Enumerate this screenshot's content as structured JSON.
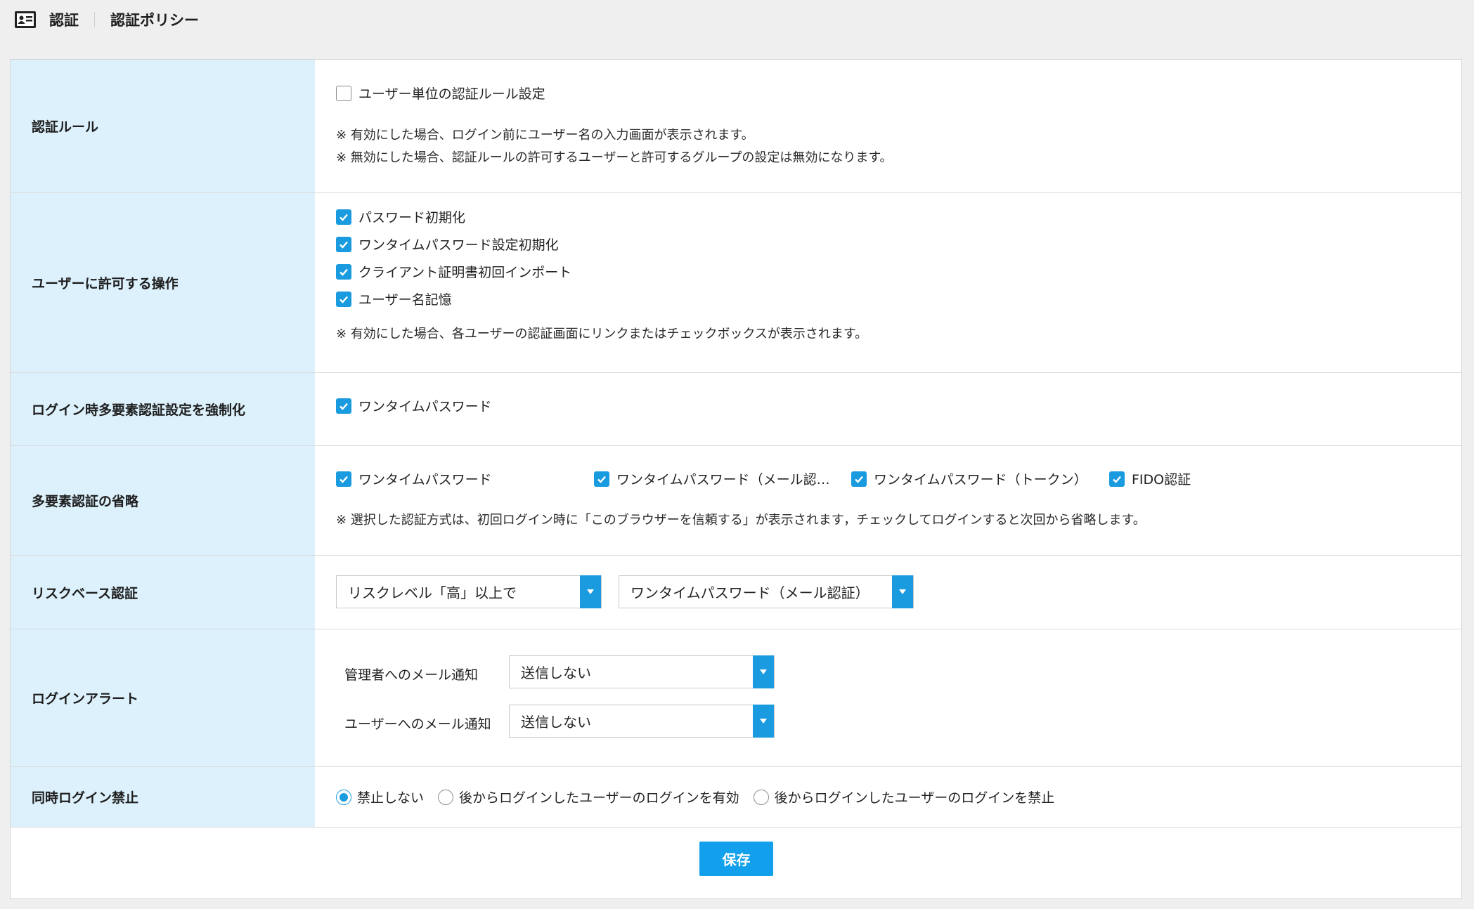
{
  "breadcrumb": [
    "認証",
    "認証ポリシー"
  ],
  "colors": {
    "accent": "#1a9be0",
    "label_bg": "#dcf1fc",
    "page_bg": "#efefef"
  },
  "sections": {
    "auth_rule": {
      "label": "認証ルール",
      "checkbox": {
        "label": "ユーザー単位の認証ルール設定",
        "checked": false
      },
      "notes": [
        "※ 有効にした場合、ログイン前にユーザー名の入力画面が表示されます。",
        "※ 無効にした場合、認証ルールの許可するユーザーと許可するグループの設定は無効になります。"
      ]
    },
    "user_ops": {
      "label": "ユーザーに許可する操作",
      "options": [
        {
          "label": "パスワード初期化",
          "checked": true
        },
        {
          "label": "ワンタイムパスワード設定初期化",
          "checked": true
        },
        {
          "label": "クライアント証明書初回インポート",
          "checked": true
        },
        {
          "label": "ユーザー名記憶",
          "checked": true
        }
      ],
      "note": "※ 有効にした場合、各ユーザーの認証画面にリンクまたはチェックボックスが表示されます。"
    },
    "mfa_force": {
      "label": "ログイン時多要素認証設定を強制化",
      "checkbox": {
        "label": "ワンタイムパスワード",
        "checked": true
      }
    },
    "mfa_skip": {
      "label": "多要素認証の省略",
      "options": [
        {
          "label": "ワンタイムパスワード",
          "checked": true
        },
        {
          "label": "ワンタイムパスワード（メール認…",
          "checked": true
        },
        {
          "label": "ワンタイムパスワード（トークン）",
          "checked": true
        },
        {
          "label": "FIDO認証",
          "checked": true
        }
      ],
      "note": "※ 選択した認証方式は、初回ログイン時に「このブラウザーを信頼する」が表示されます，チェックしてログインすると次回から省略します。"
    },
    "risk_based": {
      "label": "リスクベース認証",
      "level_select": "リスクレベル「高」以上で",
      "method_select": "ワンタイムパスワード（メール認証）"
    },
    "login_alert": {
      "label": "ログインアラート",
      "admin_label": "管理者へのメール通知",
      "admin_value": "送信しない",
      "user_label": "ユーザーへのメール通知",
      "user_value": "送信しない"
    },
    "concurrent": {
      "label": "同時ログイン禁止",
      "options": [
        {
          "label": "禁止しない",
          "selected": true
        },
        {
          "label": "後からログインしたユーザーのログインを有効",
          "selected": false
        },
        {
          "label": "後からログインしたユーザーのログインを禁止",
          "selected": false
        }
      ]
    }
  },
  "save_label": "保存"
}
